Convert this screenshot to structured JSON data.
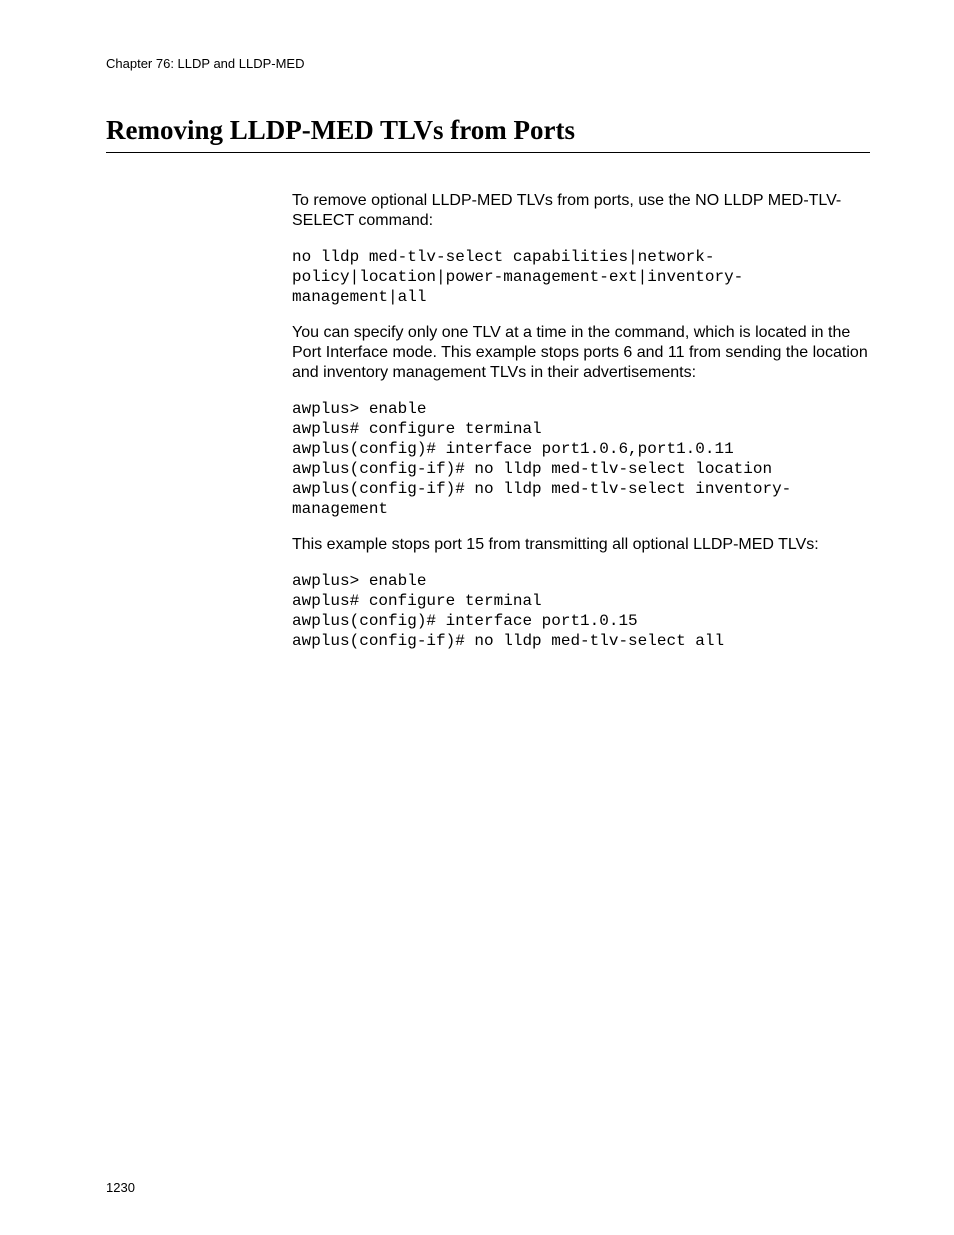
{
  "header": {
    "chapter": "Chapter 76: LLDP and LLDP-MED"
  },
  "title": "Removing LLDP-MED TLVs from Ports",
  "content": {
    "para1": "To remove optional LLDP-MED TLVs from ports, use the NO LLDP MED-TLV-SELECT command:",
    "code1": "no lldp med-tlv-select capabilities|network-policy|location|power-management-ext|inventory-management|all",
    "para2": "You can specify only one TLV at a time in the command, which is located in the Port Interface mode. This example stops ports 6 and 11 from sending the location and inventory management TLVs in their advertisements:",
    "code2": "awplus> enable\nawplus# configure terminal\nawplus(config)# interface port1.0.6,port1.0.11\nawplus(config-if)# no lldp med-tlv-select location\nawplus(config-if)# no lldp med-tlv-select inventory-management",
    "para3": "This example stops port 15 from transmitting all optional LLDP-MED TLVs:",
    "code3": "awplus> enable\nawplus# configure terminal\nawplus(config)# interface port1.0.15\nawplus(config-if)# no lldp med-tlv-select all"
  },
  "pageNumber": "1230"
}
